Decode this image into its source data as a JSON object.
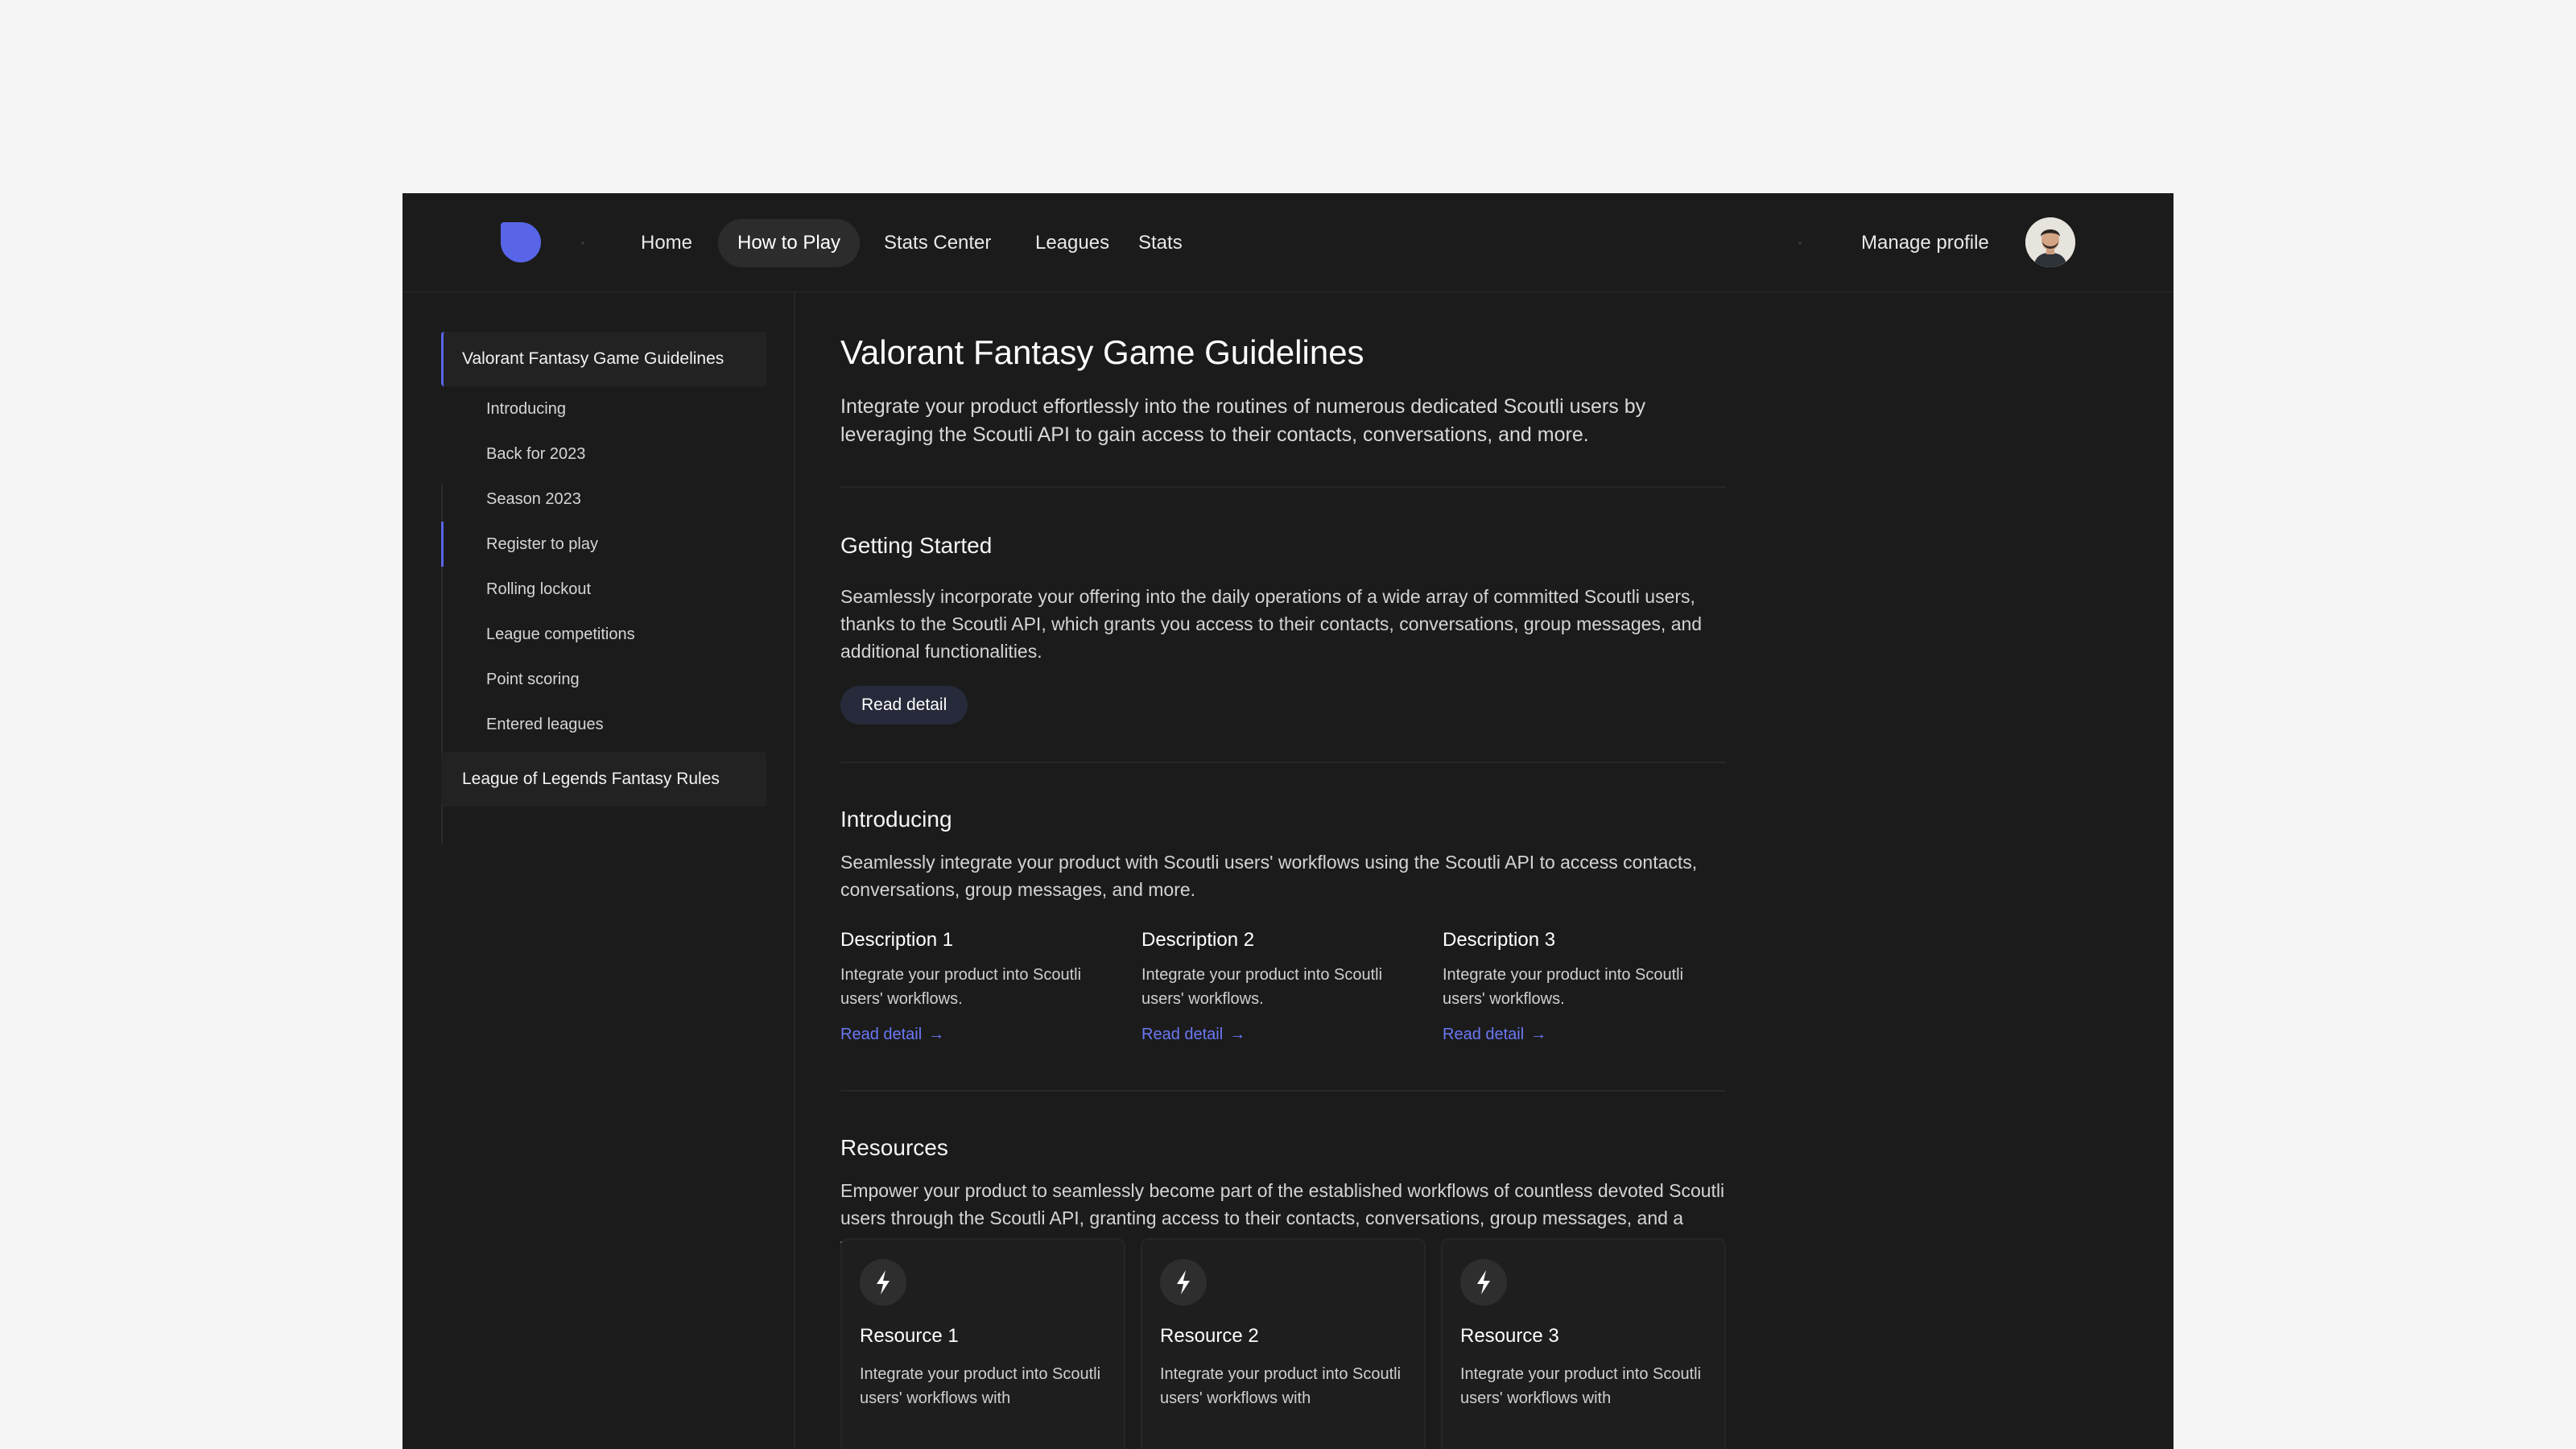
{
  "nav": {
    "items": [
      "Home",
      "How to Play",
      "Stats Center",
      "Leagues",
      "Stats"
    ],
    "active": "How to Play",
    "manage_profile": "Manage profile"
  },
  "sidebar": {
    "groups": [
      {
        "label": "Valorant Fantasy Game Guidelines",
        "active": true
      },
      {
        "label": "League of Legends Fantasy Rules",
        "active": false
      }
    ],
    "items": [
      {
        "label": "Introducing"
      },
      {
        "label": "Back for 2023"
      },
      {
        "label": "Season 2023"
      },
      {
        "label": "Register to play",
        "active": true
      },
      {
        "label": "Rolling lockout"
      },
      {
        "label": "League competitions"
      },
      {
        "label": "Point scoring"
      },
      {
        "label": "Entered leagues"
      }
    ]
  },
  "main": {
    "title": "Valorant Fantasy Game Guidelines",
    "lead": "Integrate your product effortlessly into the routines of numerous dedicated Scoutli users by leveraging the Scoutli API to gain access to their contacts, conversations, and more.",
    "getting_started": {
      "title": "Getting Started",
      "text": "Seamlessly incorporate your offering into the daily operations of a wide array of committed Scoutli users, thanks to the Scoutli API, which grants you access to their contacts, conversations, group messages, and additional functionalities.",
      "button": "Read detail"
    },
    "introducing": {
      "title": "Introducing",
      "text": "Seamlessly integrate your product with Scoutli users' workflows using the Scoutli API to access contacts, conversations, group messages, and more.",
      "descriptions": [
        {
          "title": "Description 1",
          "text": "Integrate your product into Scoutli users' workflows.",
          "link": "Read detail"
        },
        {
          "title": "Description 2",
          "text": "Integrate your product into Scoutli users' workflows.",
          "link": "Read detail"
        },
        {
          "title": "Description 3",
          "text": "Integrate your product into Scoutli users' workflows.",
          "link": "Read detail"
        }
      ]
    },
    "resources": {
      "title": "Resources",
      "text": "Empower your product to seamlessly become part of the established workflows of countless devoted Scoutli users through the Scoutli API, granting access to their contacts, conversations, group messages, and a variety of other features.",
      "cards": [
        {
          "icon": "lightning-icon",
          "title": "Resource 1",
          "text": "Integrate your product into Scoutli users' workflows with"
        },
        {
          "icon": "lightning-icon",
          "title": "Resource 2",
          "text": "Integrate your product into Scoutli users' workflows with"
        },
        {
          "icon": "lightning-icon",
          "title": "Resource 3",
          "text": "Integrate your product into Scoutli users' workflows with"
        }
      ]
    }
  },
  "colors": {
    "accent": "#5865e8",
    "link": "#6b78f5",
    "background": "#1b1b1b",
    "page": "#f5f5f5"
  }
}
